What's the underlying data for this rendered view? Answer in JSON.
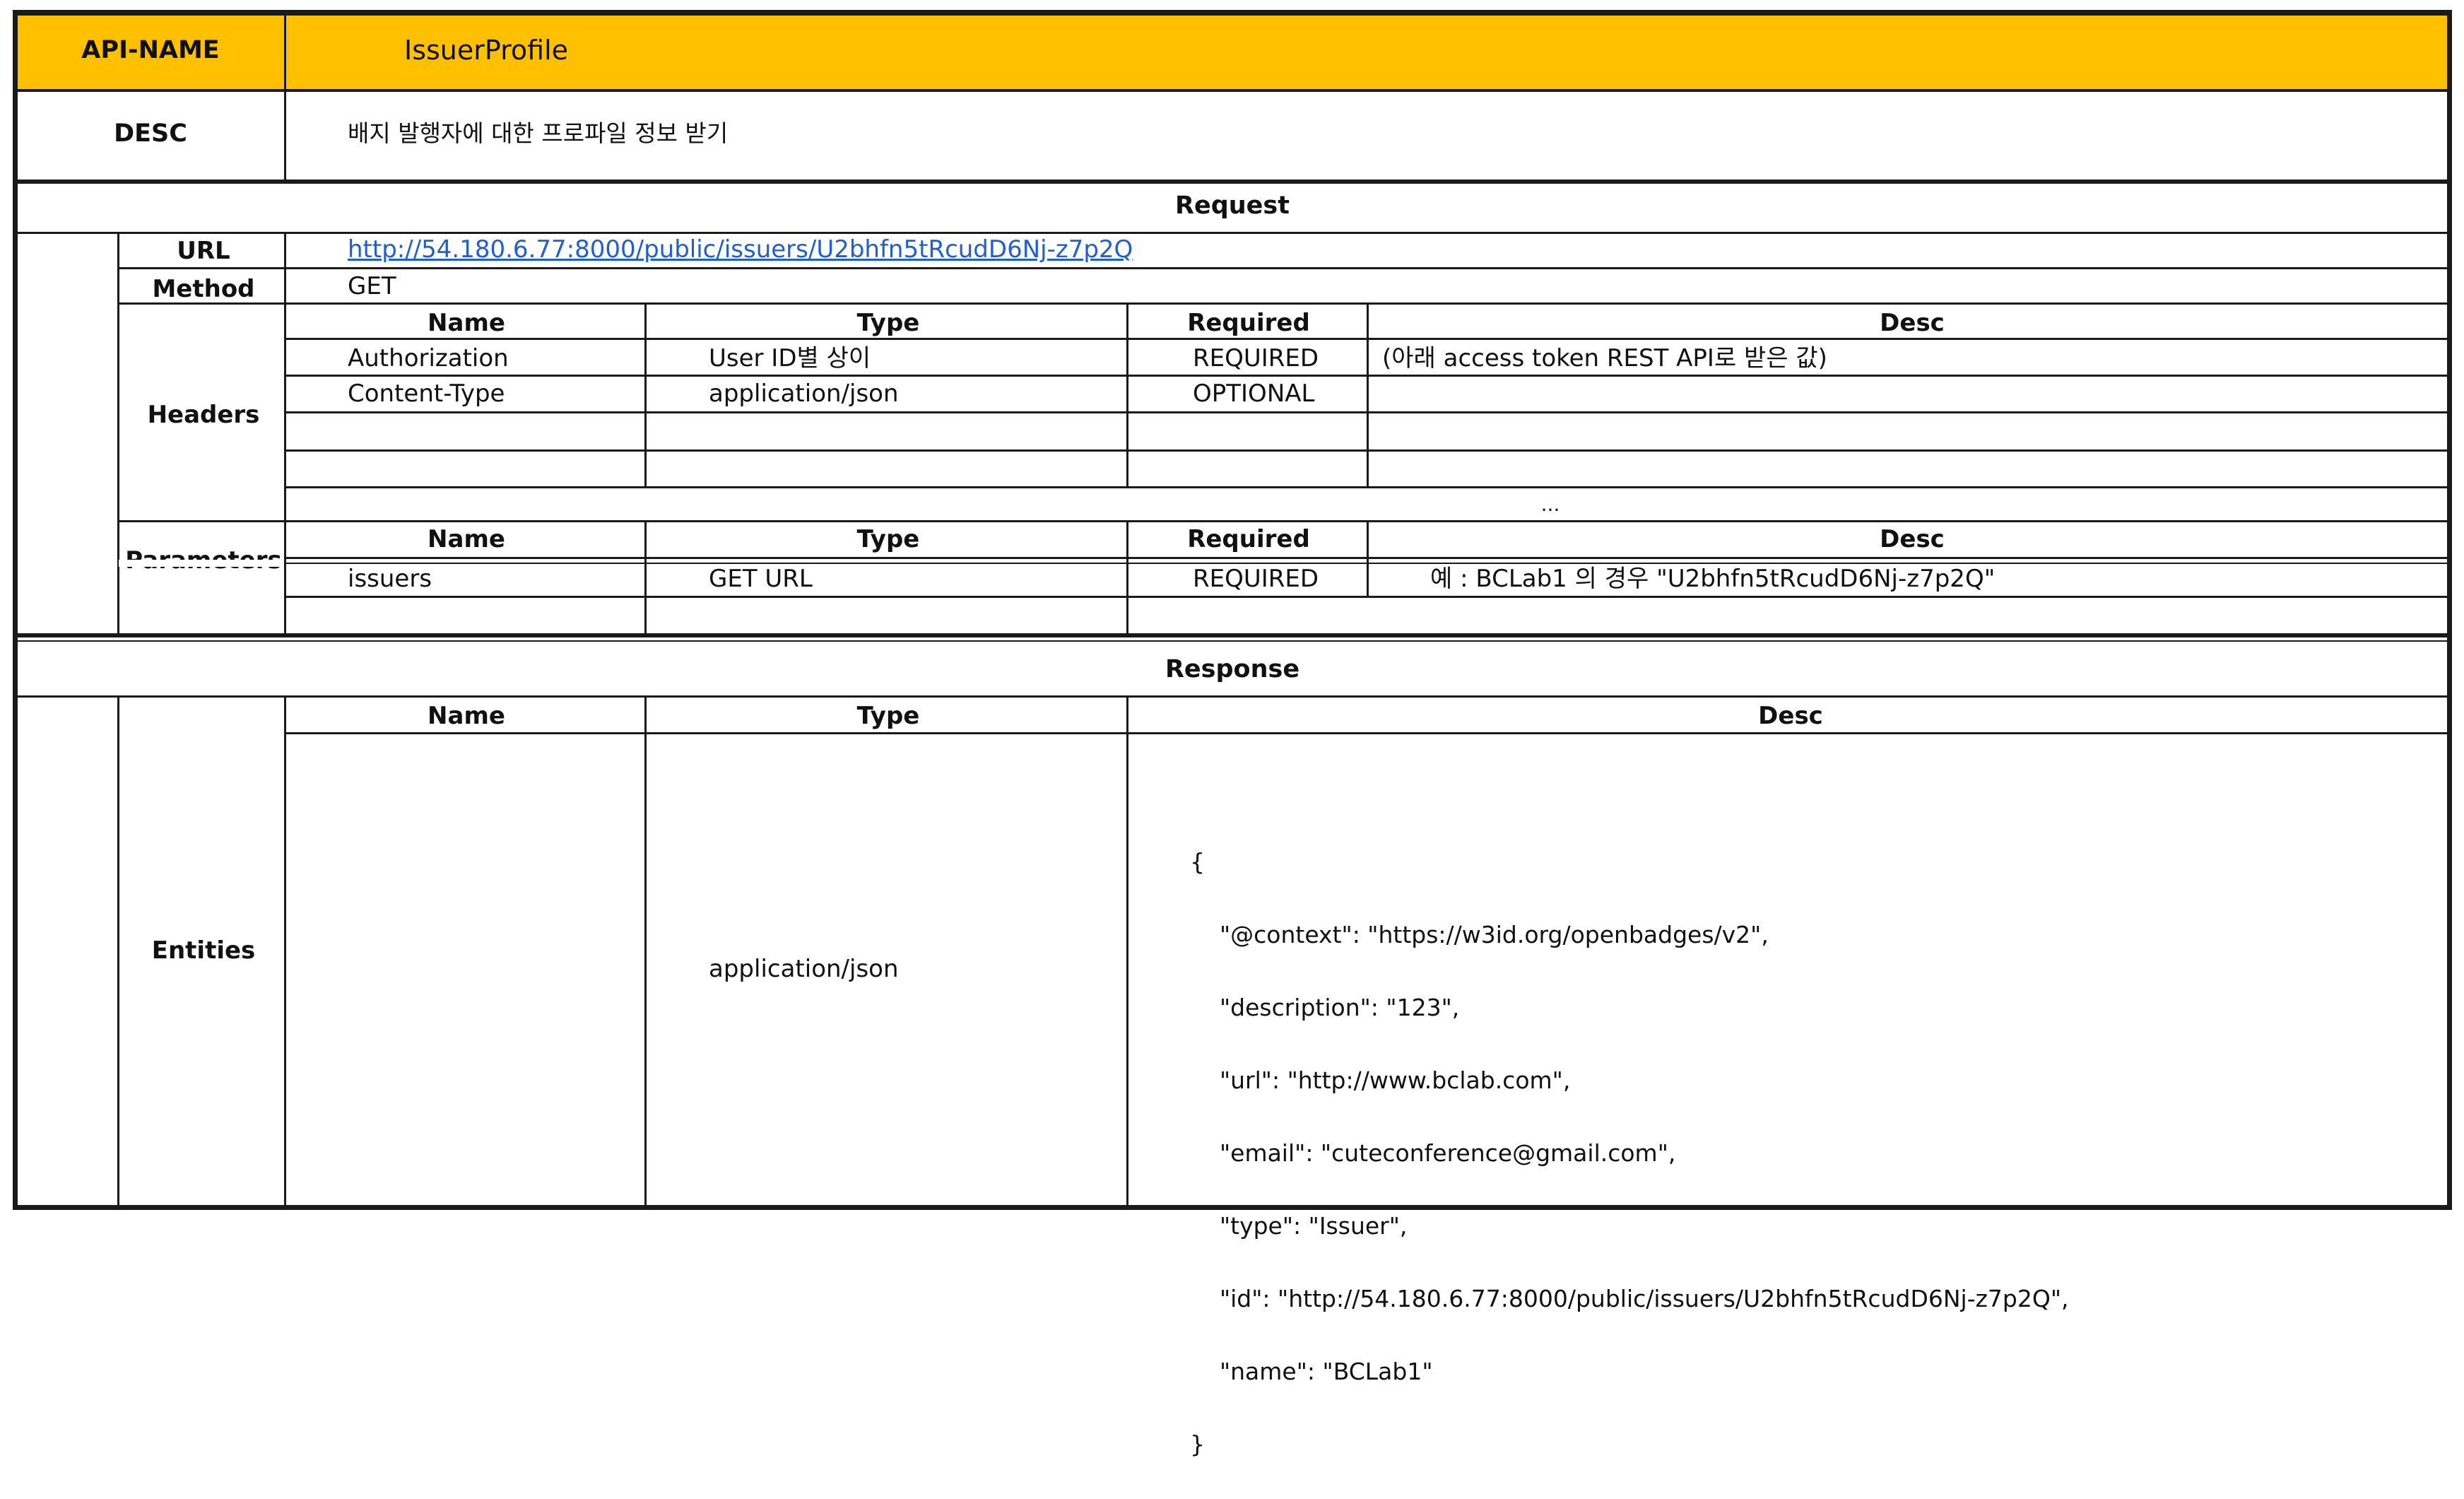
{
  "api": {
    "label": "API-NAME",
    "name": "IssuerProfile"
  },
  "desc": {
    "label": "DESC",
    "value": "배지 발행자에 대한 프로파일 정보 받기"
  },
  "request": {
    "title": "Request",
    "url_label": "URL",
    "url": "http://54.180.6.77:8000/public/issuers/U2bhfn5tRcudD6Nj-z7p2Q",
    "method_label": "Method",
    "method": "GET",
    "headers": {
      "label": "Headers",
      "columns": [
        "Name",
        "Type",
        "Required",
        "Desc"
      ],
      "rows": [
        [
          "Authorization",
          "User ID별 상이",
          "REQUIRED",
          "(아래 access token REST API로 받은 값)"
        ],
        [
          "Content-Type",
          "application/json",
          "OPTIONAL",
          ""
        ]
      ],
      "ellipsis": "..."
    },
    "parameters": {
      "label": "Parameters",
      "columns": [
        "Name",
        "Type",
        "Required",
        "Desc"
      ],
      "rows": [
        [
          "issuers",
          "GET URL",
          "REQUIRED",
          "예 : BCLab1 의 경우 \"U2bhfn5tRcudD6Nj-z7p2Q\""
        ]
      ]
    }
  },
  "response": {
    "title": "Response",
    "entities_label": "Entities",
    "columns": [
      "Name",
      "Type",
      "Desc"
    ],
    "type": "application/json",
    "json_lines": [
      "{",
      "    \"@context\": \"https://w3id.org/openbadges/v2\",",
      "    \"description\": \"123\",",
      "    \"url\": \"http://www.bclab.com\",",
      "    \"email\": \"cuteconference@gmail.com\",",
      "    \"type\": \"Issuer\",",
      "    \"id\": \"http://54.180.6.77:8000/public/issuers/U2bhfn5tRcudD6Nj-z7p2Q\",",
      "    \"name\": \"BCLab1\"",
      "}"
    ]
  },
  "colors": {
    "header_bg": "#ffc000",
    "link": "#1f5fd1",
    "border": "#1a1a1a"
  }
}
